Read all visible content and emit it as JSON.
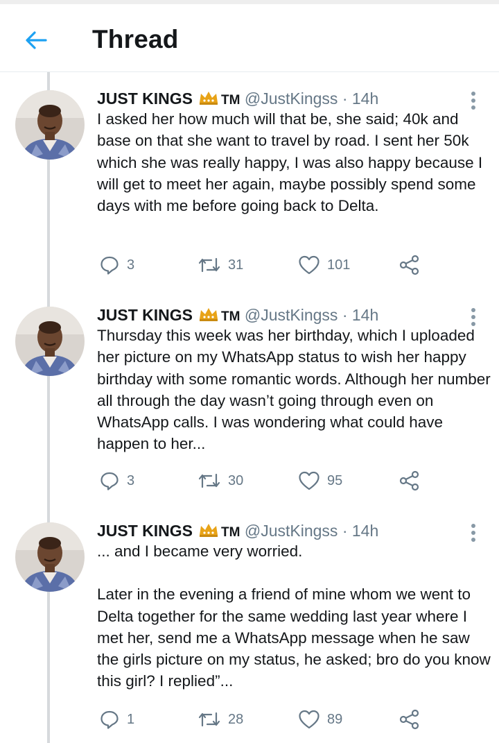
{
  "header": {
    "title": "Thread",
    "back_icon": "arrow-left-icon",
    "accent": "#1da1f2"
  },
  "tweets": [
    {
      "name": "JUST KINGS",
      "badge": "TM",
      "handle": "@JustKingss",
      "separator": "·",
      "time": "14h",
      "paragraphs": [
        "I asked her how much will that be, she said; 40k and base on that she want to travel by road. I sent her 50k which she was really happy, I was also happy because I will get to meet her again, maybe possibly spend some days with me before going back to Delta."
      ],
      "replies": "3",
      "retweets": "31",
      "likes": "101"
    },
    {
      "name": "JUST KINGS",
      "badge": "TM",
      "handle": "@JustKingss",
      "separator": "·",
      "time": "14h",
      "paragraphs": [
        "Thursday this week was her birthday, which I uploaded her picture on my WhatsApp status to wish her happy birthday with some romantic words. Although her number all through the day wasn’t going through even on WhatsApp calls. I was wondering what could have happen to her..."
      ],
      "replies": "3",
      "retweets": "30",
      "likes": "95"
    },
    {
      "name": "JUST KINGS",
      "badge": "TM",
      "handle": "@JustKingss",
      "separator": "·",
      "time": "14h",
      "paragraphs": [
        "... and I became very worried.",
        "Later in the evening a friend of mine whom we went to Delta together for the same wedding last year where I met her, send me a WhatsApp message when he saw the girls picture on my status, he asked; bro do you know this girl? I replied”..."
      ],
      "replies": "1",
      "retweets": "28",
      "likes": "89"
    }
  ],
  "icons": {
    "crown": "crown-icon",
    "more": "more-vertical-icon",
    "reply": "reply-icon",
    "retweet": "retweet-icon",
    "like": "heart-icon",
    "share": "share-icon"
  },
  "colors": {
    "icon_gray": "#657786",
    "text": "#14171a",
    "thread_line": "#d6d9dc",
    "crown_gold": "#e8a317"
  }
}
